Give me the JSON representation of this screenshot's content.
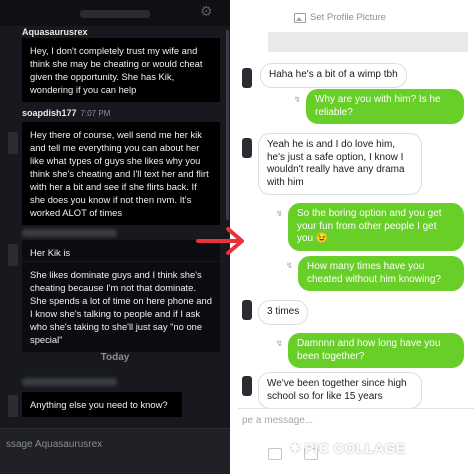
{
  "left_chat": {
    "messages": [
      {
        "author": "Aquasaurusrex",
        "text": "Hey, I don't completely trust my wife and think she may be cheating or would cheat given the opportunity. She has Kik, wondering if you can help"
      },
      {
        "author": "soapdish177",
        "time": "7:07 PM",
        "text": "Hey there of course, well send me her kik and tell me everything you can about her like what types of guys she likes why you think she's cheating and I'll text her and flirt with her a bit and see if she flirts back. If she does you know if not then nvm. It's worked ALOT of times"
      },
      {
        "text": "Her Kik is"
      },
      {
        "text": "She likes dominate guys and I think she's cheating because I'm not that dominate. She spends a lot of time on here phone and I know she's talking to people and if I ask who she's taking to she'll just say \"no one special\""
      },
      {
        "text": "Anything else you need to know?"
      }
    ],
    "day_divider": "Today",
    "input_placeholder": "ssage Aquasaurusrex"
  },
  "right_chat": {
    "set_profile_label": "Set Profile Picture",
    "messages": [
      {
        "side": "in",
        "text": "Haha he's a bit of a wimp tbh"
      },
      {
        "side": "out",
        "text": "Why are you with him? Is he reliable?"
      },
      {
        "side": "in",
        "text": "Yeah he is and I do love him, he's just a safe option, I know I wouldn't really have any drama with him"
      },
      {
        "side": "out",
        "text": "So the boring option and you get your fun from other people I get you 😉"
      },
      {
        "side": "out",
        "text": "How many times have you cheated without him knowing?"
      },
      {
        "side": "in",
        "text": "3 times"
      },
      {
        "side": "out",
        "text": "Damnnn and how long have you been together?"
      },
      {
        "side": "in",
        "text": "We've been together since high school so for like 15 years"
      }
    ],
    "input_placeholder": "pe a message..."
  },
  "watermark": {
    "text": "PIC COLLAGE",
    "star": "✱"
  },
  "colors": {
    "kik_green": "#68ce28",
    "arrow_red": "#e8323c",
    "left_bg": "#17191e"
  },
  "icons": [
    "gear-icon",
    "image-icon",
    "camera-icon",
    "gallery-icon",
    "arrow-right-icon"
  ]
}
